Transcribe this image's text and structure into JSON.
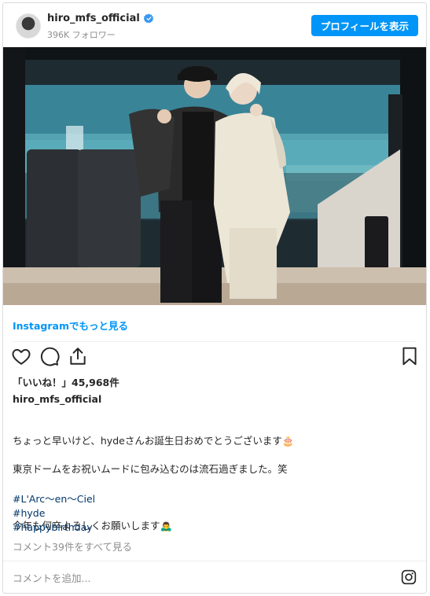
{
  "header": {
    "username": "hiro_mfs_official",
    "followers": "396K フォロワー",
    "profile_button": "プロフィールを表示"
  },
  "post": {
    "more_link": "Instagramでもっと見る",
    "likes": "「いいね！」45,968件",
    "owner": "hiro_mfs_official",
    "caption_line1": "ちょっと早いけど、hydeさんお誕生日おめでとうございます🎂",
    "caption_line2": "東京ドームをお祝いムードに包み込むのは流石過ぎました。笑",
    "caption_line3": "今年も何卒よろしくお願いします🙇‍♂️",
    "hashtags": [
      "#L'Arc〜en〜Ciel",
      "#hyde",
      "#happybirthday"
    ],
    "view_comments": "コメント39件をすべて見る"
  },
  "footer": {
    "add_comment": "コメントを追加..."
  },
  "icons": {
    "verified": "verified-badge-icon",
    "like": "heart-icon",
    "comment": "comment-icon",
    "share": "share-icon",
    "save": "bookmark-icon",
    "instagram": "instagram-icon"
  },
  "colors": {
    "accent": "#0095f6",
    "hashtag": "#00376b",
    "muted": "#8e8e8e"
  }
}
